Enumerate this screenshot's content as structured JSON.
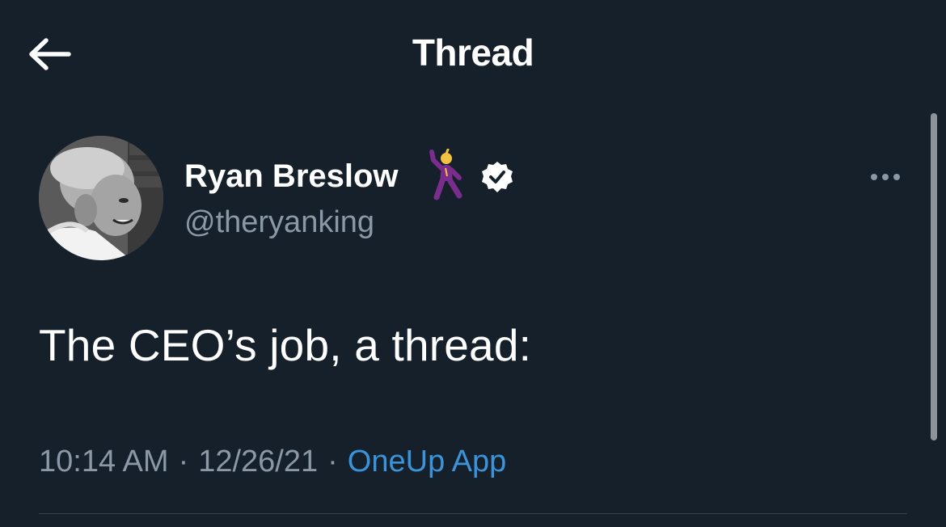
{
  "header": {
    "title": "Thread",
    "back_icon": "arrow-left-icon"
  },
  "tweet": {
    "author": {
      "display_name": "Ryan Breslow",
      "name_emoji": "dancing-man-emoji",
      "verified_icon": "verified-badge-icon",
      "handle": "@theryanking"
    },
    "text": "The CEO’s job, a thread:",
    "time": "10:14 AM",
    "date": "12/26/21",
    "source": "OneUp App",
    "separator": "·",
    "more_icon": "more-horizontal-icon"
  },
  "colors": {
    "background": "#15202b",
    "text_primary": "#ffffff",
    "text_secondary": "#8b98a5",
    "link": "#3b94d9",
    "divider": "#38444d",
    "verified_badge": "#ffffff",
    "emoji_purple": "#7b2d8e"
  }
}
